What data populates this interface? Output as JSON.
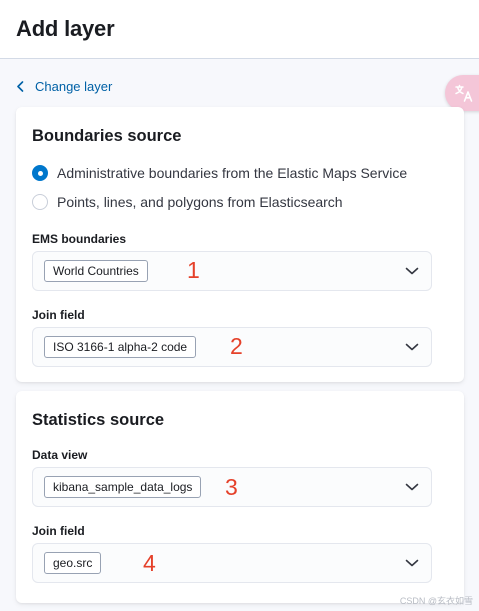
{
  "header": {
    "title": "Add layer"
  },
  "back_link": {
    "label": "Change layer"
  },
  "boundaries_panel": {
    "title": "Boundaries source",
    "radio_options": [
      {
        "label": "Administrative boundaries from the Elastic Maps Service",
        "checked": true
      },
      {
        "label": "Points, lines, and polygons from Elasticsearch",
        "checked": false
      }
    ],
    "ems_boundaries": {
      "label": "EMS boundaries",
      "value": "World Countries",
      "annotation": "1"
    },
    "join_field": {
      "label": "Join field",
      "value": "ISO 3166-1 alpha-2 code",
      "annotation": "2"
    }
  },
  "statistics_panel": {
    "title": "Statistics source",
    "data_view": {
      "label": "Data view",
      "value": "kibana_sample_data_logs",
      "annotation": "3"
    },
    "join_field": {
      "label": "Join field",
      "value": "geo.src",
      "annotation": "4"
    }
  },
  "watermark": "CSDN @玄衣如雪",
  "colors": {
    "accent": "#0077cc",
    "link": "#0061a6",
    "annotation": "#e5412a",
    "translate_button": "#f4c6d8"
  },
  "icons": {
    "back": "chevron-left-icon",
    "dropdown": "chevron-down-icon",
    "translate": "translate-icon"
  }
}
